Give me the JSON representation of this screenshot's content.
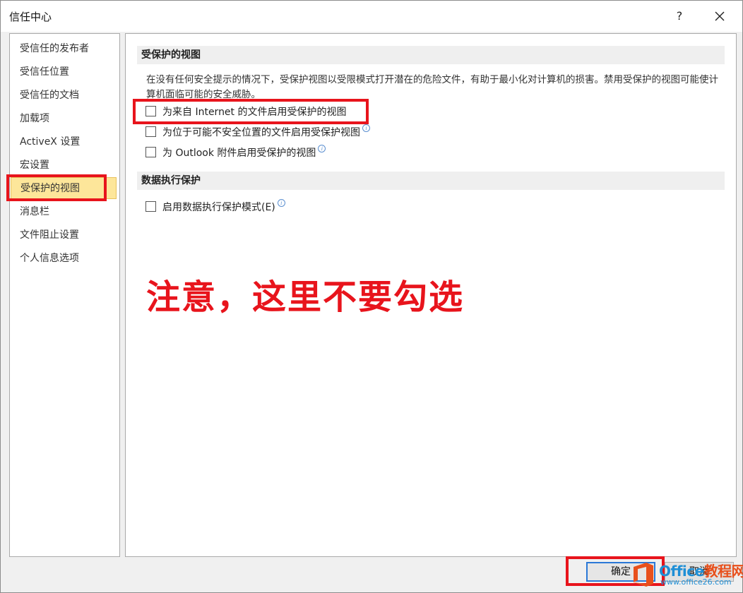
{
  "window": {
    "title": "信任中心",
    "help_label": "?"
  },
  "sidebar": {
    "items": [
      {
        "label": "受信任的发布者"
      },
      {
        "label": "受信任位置"
      },
      {
        "label": "受信任的文档"
      },
      {
        "label": "加载项"
      },
      {
        "label": "ActiveX 设置"
      },
      {
        "label": "宏设置"
      },
      {
        "label": "受保护的视图"
      },
      {
        "label": "消息栏"
      },
      {
        "label": "文件阻止设置"
      },
      {
        "label": "个人信息选项"
      }
    ],
    "selected_index": 6
  },
  "protected_view": {
    "header": "受保护的视图",
    "description": "在没有任何安全提示的情况下，受保护视图以受限模式打开潜在的危险文件，有助于最小化对计算机的损害。禁用受保护的视图可能使计算机面临可能的安全威胁。",
    "options": [
      {
        "label": "为来自 Internet 的文件启用受保护的视图",
        "checked": false
      },
      {
        "label": "为位于可能不安全位置的文件启用受保护视图",
        "checked": false
      },
      {
        "label": "为 Outlook 附件启用受保护的视图",
        "checked": false
      }
    ]
  },
  "dep": {
    "header": "数据执行保护",
    "option_label": "启用数据执行保护模式(E)",
    "checked": false
  },
  "annotation": {
    "text": "注意，这里不要勾选",
    "color": "#e8141c"
  },
  "buttons": {
    "ok_label": "确定",
    "cancel_label": "取消"
  },
  "watermark": {
    "title_prefix": "Office",
    "title_suffix": "教程网",
    "url": "www.office26.com"
  }
}
